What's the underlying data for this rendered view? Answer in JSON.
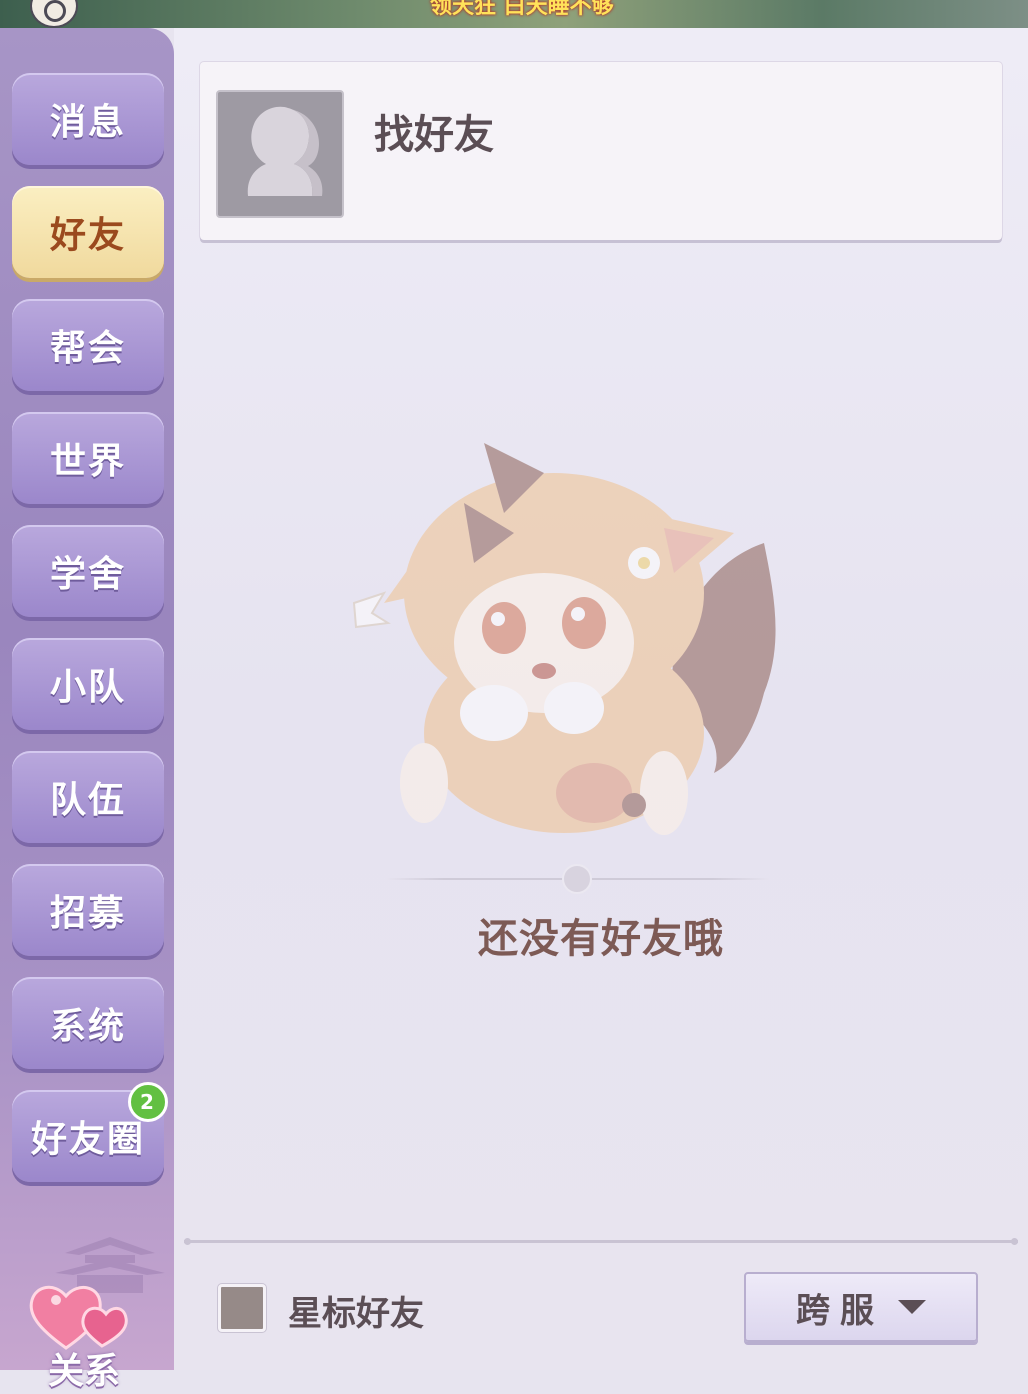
{
  "top_ticker": "领天狂 白天睡不够",
  "sidebar": {
    "items": [
      {
        "label": "消息"
      },
      {
        "label": "好友"
      },
      {
        "label": "帮会"
      },
      {
        "label": "世界"
      },
      {
        "label": "学舍"
      },
      {
        "label": "小队"
      },
      {
        "label": "队伍"
      },
      {
        "label": "招募"
      },
      {
        "label": "系统"
      },
      {
        "label": "好友圈",
        "badge": "2"
      }
    ],
    "active_index": 1,
    "relation_label": "关系"
  },
  "main": {
    "find_friend_label": "找好友",
    "empty_text": "还没有好友哦",
    "starred_label": "星标好友",
    "cross_server_label": "跨服"
  },
  "colors": {
    "sidebar_bg": "#9a86be",
    "button_bg": "#a895d4",
    "active_button_bg": "#f5e3ad",
    "active_text": "#9b4a1e",
    "badge_green": "#62c042",
    "panel_bg": "#e9e6f1",
    "empty_text": "#7d5a55"
  }
}
